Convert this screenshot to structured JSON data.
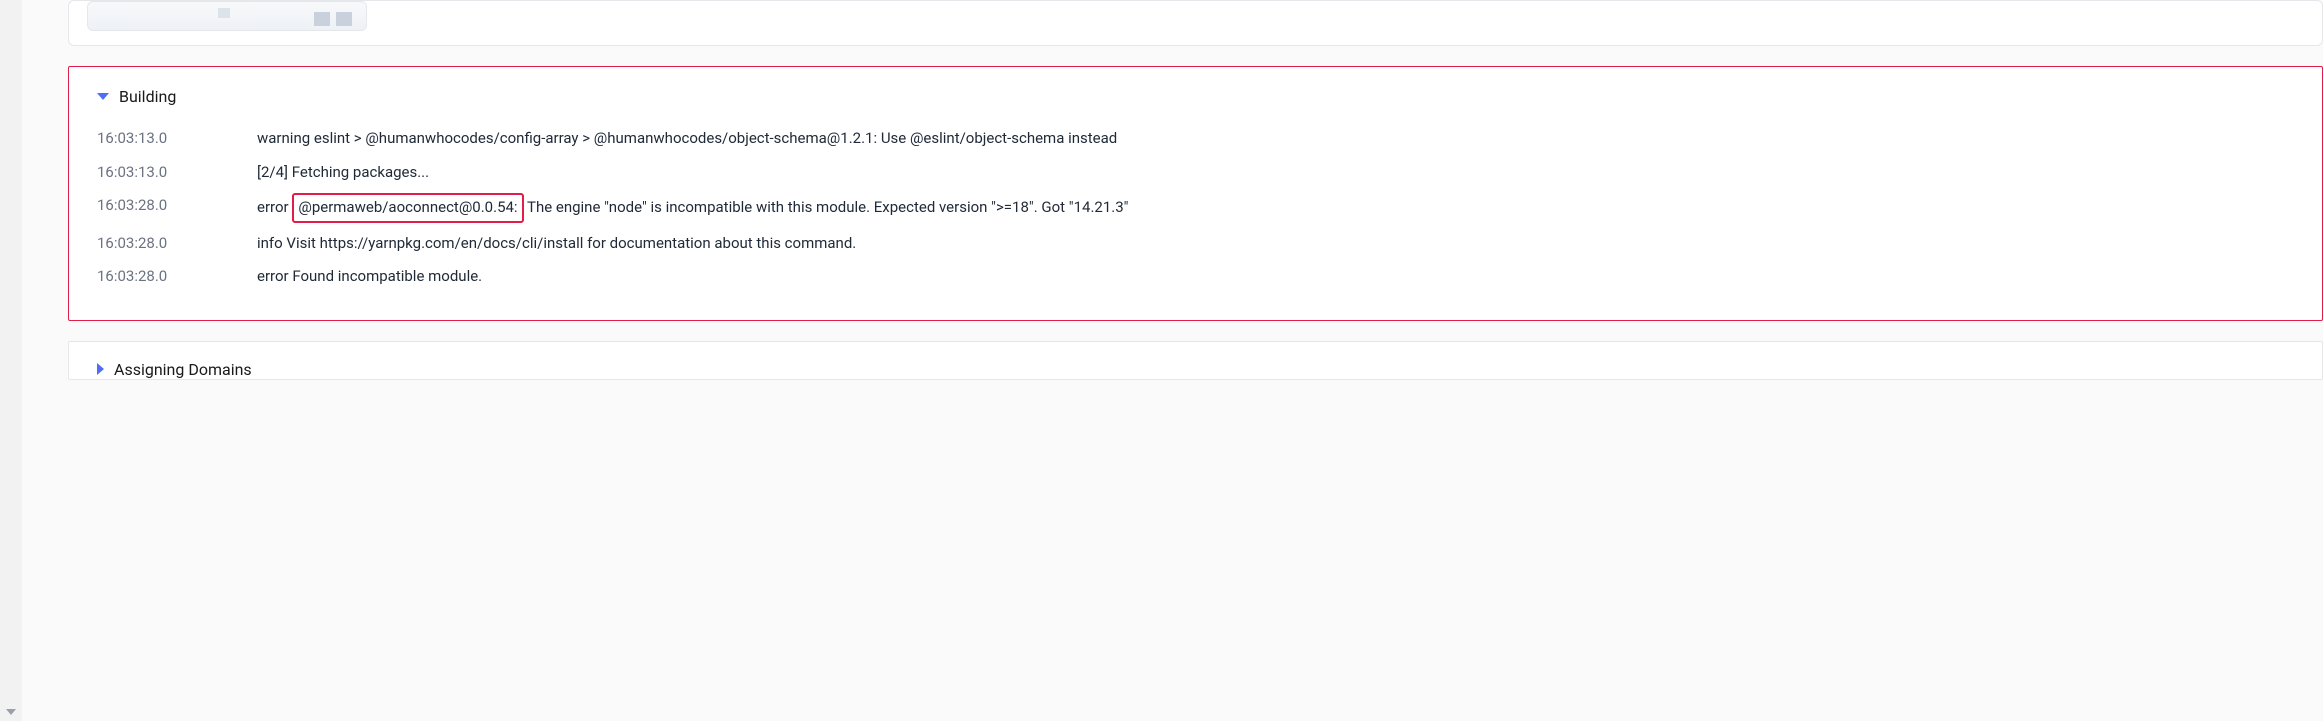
{
  "sections": {
    "building": {
      "title": "Building",
      "expanded": true
    },
    "assigning": {
      "title": "Assigning Domains",
      "expanded": false
    }
  },
  "logs": [
    {
      "ts": "16:03:13.0",
      "msg": "warning eslint > @humanwhocodes/config-array > @humanwhocodes/object-schema@1.2.1: Use @eslint/object-schema instead",
      "highlight": null
    },
    {
      "ts": "16:03:13.0",
      "msg": "[2/4] Fetching packages...",
      "highlight": null
    },
    {
      "ts": "16:03:28.0",
      "msg_pre": "error ",
      "highlight": "@permaweb/aoconnect@0.0.54:",
      "msg_post": " The engine \"node\" is incompatible with this module. Expected version \">=18\". Got \"14.21.3\""
    },
    {
      "ts": "16:03:28.0",
      "msg": "info Visit https://yarnpkg.com/en/docs/cli/install for documentation about this command.",
      "highlight": null
    },
    {
      "ts": "16:03:28.0",
      "msg": "error Found incompatible module.",
      "highlight": null
    }
  ]
}
